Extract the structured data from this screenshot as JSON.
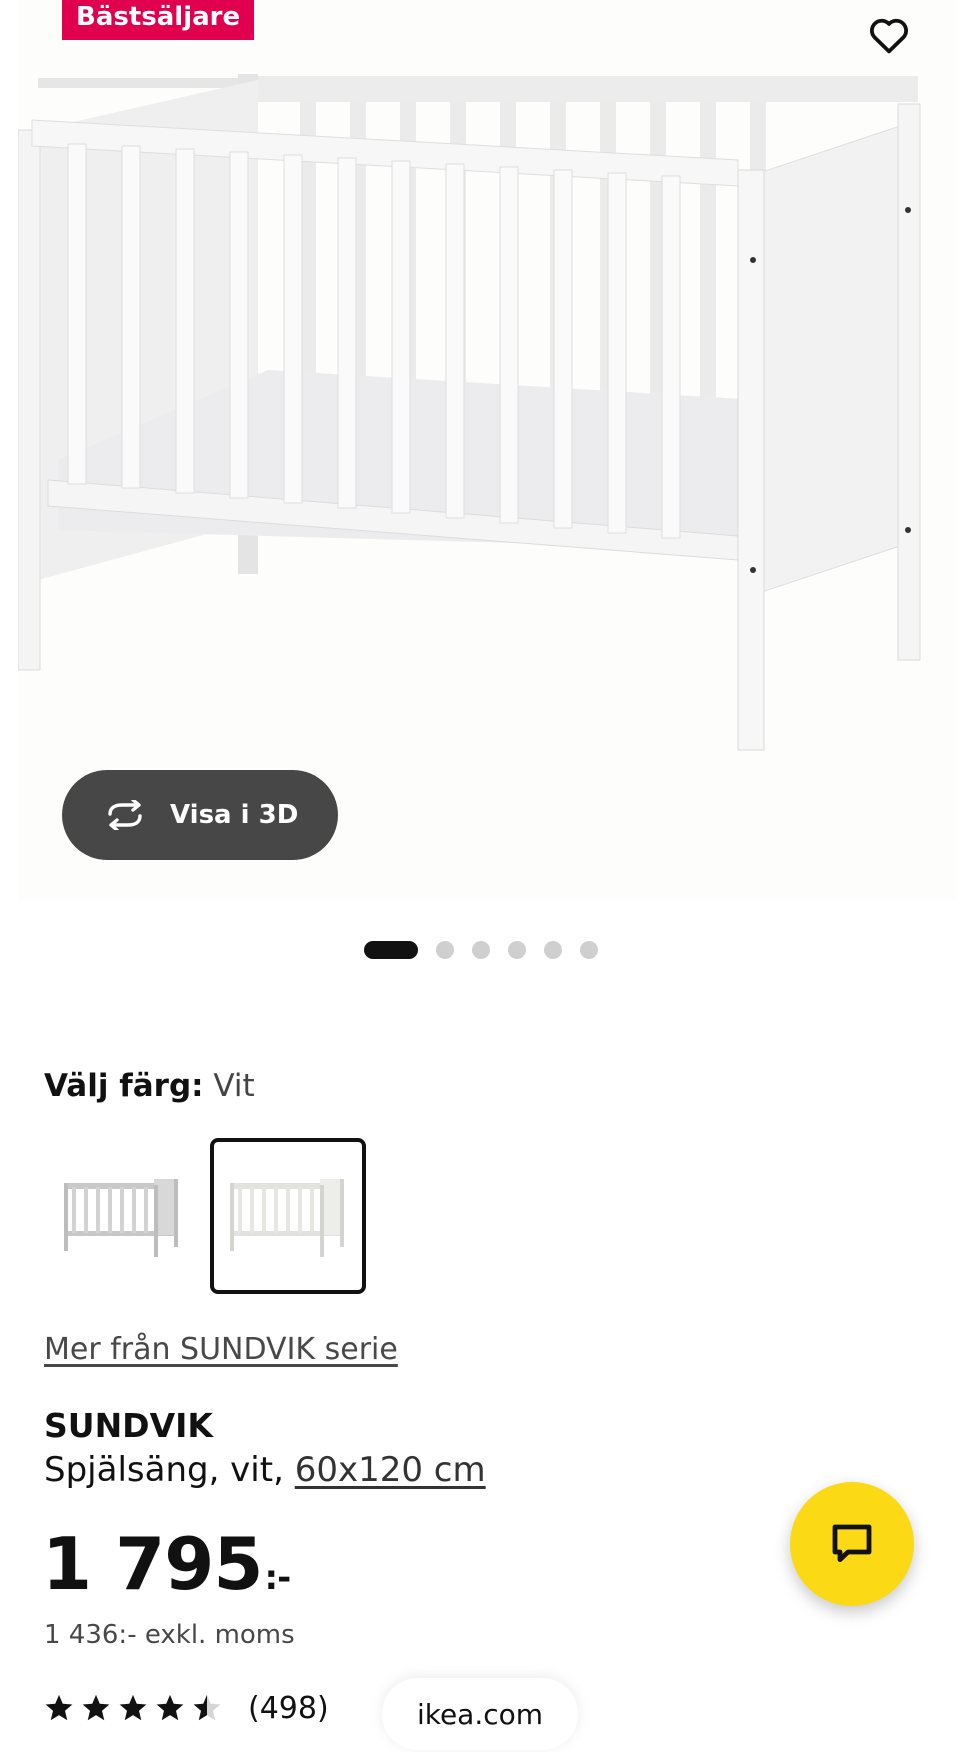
{
  "hero": {
    "badge": "Bästsäljare",
    "view3d_label": "Visa i 3D",
    "image_count": 6,
    "active_image": 1
  },
  "color": {
    "label": "Välj färg:",
    "value": "Vit",
    "swatches": [
      {
        "name": "SUNDVIK grå",
        "selected": false
      },
      {
        "name": "SUNDVIK vit",
        "selected": true
      }
    ]
  },
  "series_link": "Mer från SUNDVIK serie",
  "product": {
    "name": "SUNDVIK",
    "desc_prefix": "Spjälsäng, vit,",
    "size": "60x120 cm",
    "price": "1 795",
    "price_suffix": ":-",
    "price_ex_vat": "1 436:- exkl. moms",
    "rating": 4.5,
    "reviews": "(498)"
  },
  "browser": {
    "domain": "ikea.com"
  },
  "colors": {
    "badge": "#e0004d",
    "chat": "#fbd914",
    "button3d": "#474747"
  },
  "icons": {
    "favorite": "heart-outline-icon",
    "rotate": "rotate-3d-icon",
    "chat": "chat-bubble-icon",
    "star": "star-icon"
  }
}
